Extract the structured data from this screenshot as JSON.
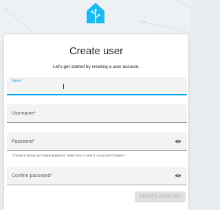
{
  "header": {
    "logo_icon": "home-assistant-logo",
    "brand_color": "#18bcf2"
  },
  "form": {
    "title": "Create user",
    "subtitle": "Let's get started by creating a user account.",
    "name_label": "Name*",
    "name_value": "",
    "username_label": "Username*",
    "password_label": "Password*",
    "password_helper": "Choose a strong and unique password. Make sure to save it, so you don't forget it.",
    "confirm_password_label": "Confirm password*",
    "eye_icon": "eye-icon",
    "submit_label": "CREATE ACCOUNT"
  },
  "colors": {
    "accent": "#03a9f4",
    "field_bg": "#f3f3f3",
    "button_disabled": "#e0e0e0"
  }
}
